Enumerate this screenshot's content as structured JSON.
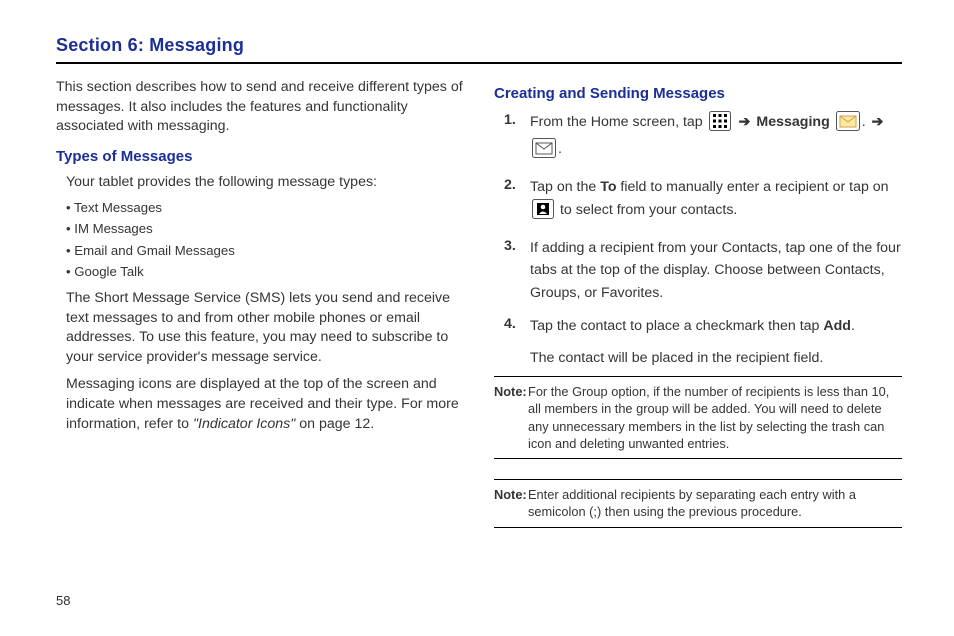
{
  "section_title": "Section 6: Messaging",
  "page_number": "58",
  "left": {
    "intro": "This section describes how to send and receive different types of messages. It also includes the features and functionality associated with messaging.",
    "heading": "Types of Messages",
    "lead": "Your tablet provides the following message types:",
    "bullets": [
      "Text Messages",
      "IM Messages",
      "Email and Gmail Messages",
      "Google Talk"
    ],
    "sms_para": "The Short Message Service (SMS) lets you send and receive text messages to and from other mobile phones or email addresses. To use this feature, you may need to subscribe to your service provider's message service.",
    "icons_para_a": "Messaging icons are displayed at the top of the screen and indicate when messages are received and their type. For more information, refer to ",
    "icons_ref": "\"Indicator Icons\"",
    "icons_para_b": "  on page 12."
  },
  "right": {
    "heading": "Creating and Sending Messages",
    "step1_a": "From the Home screen, tap ",
    "step1_msg": "Messaging",
    "step2_a": "Tap on the ",
    "step2_to": "To",
    "step2_b": " field to manually enter a recipient or tap on ",
    "step2_c": " to select from your contacts.",
    "step3": "If adding a recipient from your Contacts, tap one of the four tabs at the top of the display. Choose between Contacts, Groups, or Favorites.",
    "step4_a": "Tap the contact to place a checkmark then tap ",
    "step4_add": "Add",
    "step4_b": ".",
    "step4_result": "The contact will be placed in the recipient field.",
    "note1": "For the Group option, if the number of recipients is less than 10, all members in the group will be added. You will need to delete any unnecessary members in the list by selecting the trash can icon and deleting unwanted entries.",
    "note2": "Enter additional recipients by separating each entry with a semicolon (;) then using the previous procedure.",
    "note_label": "Note:"
  }
}
